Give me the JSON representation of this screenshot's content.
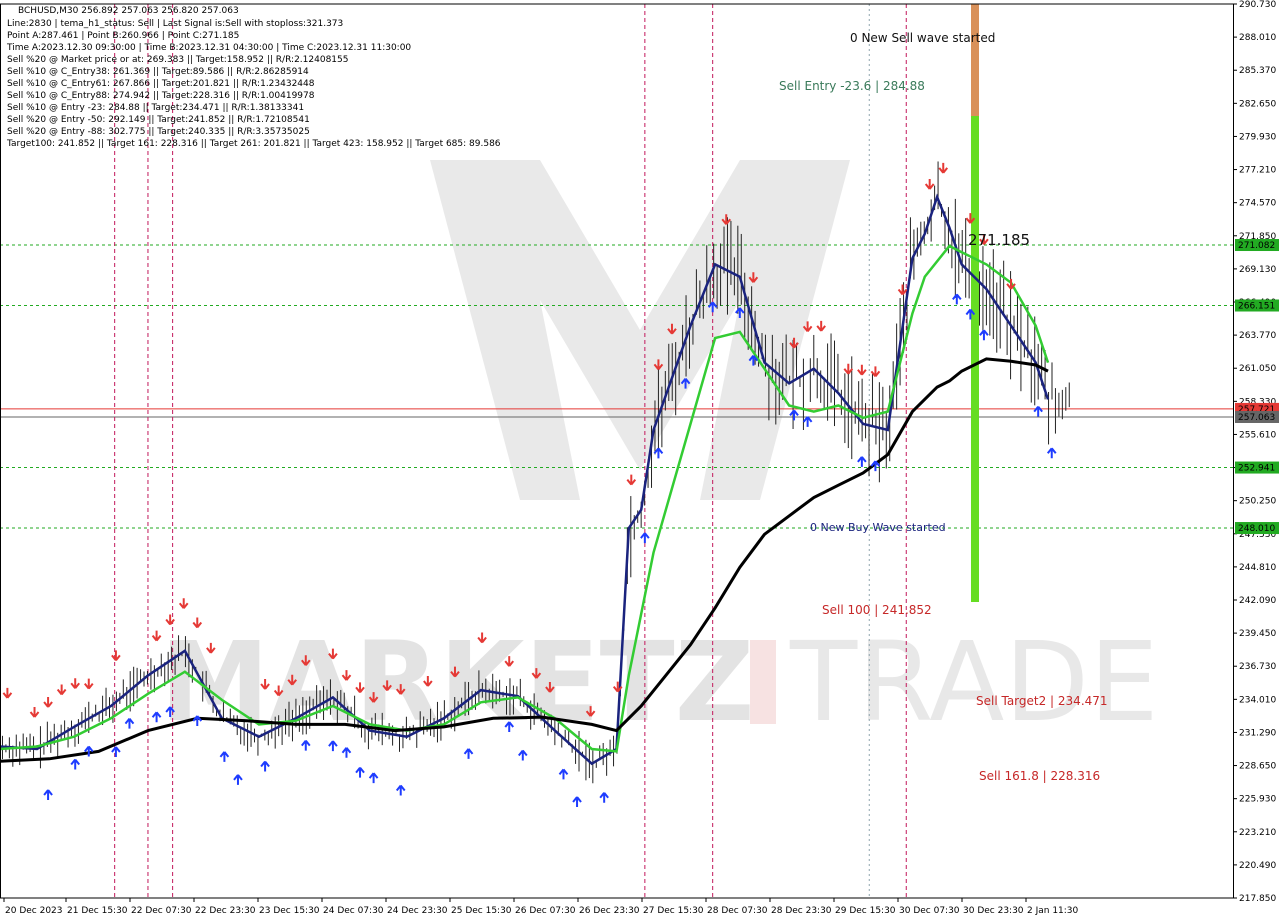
{
  "chart_data": {
    "type": "candlestick",
    "symbol_line": "BCHUSD,M30  256.892 257.063 256.820 257.063",
    "info_lines": [
      "Line:2830 | tema_h1_status: Sell | Last Signal is:Sell with stoploss:321.373",
      "Point A:287.461 | Point B:260.966 | Point C:271.185",
      "Time A:2023.12.30 09:30:00 | Time B:2023.12.31 04:30:00 | Time C:2023.12.31 11:30:00",
      "Sell %20 @ Market price or at: 269.383 || Target:158.952 || R/R:2.12408155",
      "Sell %10 @ C_Entry38: 261.369 || Target:89.586 || R/R:2.86285914",
      "Sell %10 @ C_Entry61: 267.866 || Target:201.821 || R/R:1.23432448",
      "Sell %10 @ C_Entry88: 274.942 || Target:228.316 || R/R:1.00419978",
      "Sell %10 @ Entry -23: 284.88 || Target:234.471 || R/R:1.38133341",
      "Sell %20 @ Entry -50: 292.149 || Target:241.852 || R/R:1.72108541",
      "Sell %20 @ Entry -88: 302.775 || Target:240.335 || R/R:3.35735025",
      "Target100: 241.852 || Target 161: 228.316 || Target 261: 201.821 || Target 423: 158.952 || Target 685: 89.586"
    ],
    "y_ticks": [
      "290.730",
      "288.010",
      "285.370",
      "282.650",
      "279.930",
      "277.210",
      "274.570",
      "271.850",
      "269.130",
      "266.490",
      "263.770",
      "261.050",
      "258.330",
      "255.610",
      "252.970",
      "250.250",
      "247.530",
      "244.810",
      "242.090",
      "239.450",
      "236.730",
      "234.010",
      "231.290",
      "228.650",
      "225.930",
      "223.210",
      "220.490",
      "217.850"
    ],
    "ylim": [
      217.85,
      290.73
    ],
    "x_ticks": [
      "20 Dec 2023",
      "21 Dec 15:30",
      "22 Dec 07:30",
      "22 Dec 23:30",
      "23 Dec 15:30",
      "24 Dec 07:30",
      "24 Dec 23:30",
      "25 Dec 15:30",
      "26 Dec 07:30",
      "26 Dec 23:30",
      "27 Dec 15:30",
      "28 Dec 07:30",
      "28 Dec 23:30",
      "29 Dec 15:30",
      "30 Dec 07:30",
      "30 Dec 23:30",
      "2 Jan 11:30"
    ],
    "price_tags": [
      {
        "value": 271.082,
        "label": "271.082",
        "color": "#22aa22"
      },
      {
        "value": 266.151,
        "label": "266.151",
        "color": "#22aa22"
      },
      {
        "value": 257.721,
        "label": "257.721",
        "color": "#e53935"
      },
      {
        "value": 257.063,
        "label": "257.063",
        "color": "#666666"
      },
      {
        "value": 252.941,
        "label": "252.941",
        "color": "#22aa22"
      },
      {
        "value": 248.01,
        "label": "248.010",
        "color": "#22aa22"
      }
    ],
    "annotations": [
      {
        "text": "0 New Sell wave started",
        "color": "#111111"
      },
      {
        "text": "Sell Entry -23.6 | 284.88",
        "color": "#3a7a5a"
      },
      {
        "text": "271.185",
        "color": "#111111"
      },
      {
        "text": "0 New Buy Wave started",
        "color": "#1a237e"
      },
      {
        "text": "Sell 100 | 241.852",
        "color": "#c62828"
      },
      {
        "text": "Sell Target2 | 234.471",
        "color": "#c62828"
      },
      {
        "text": "Sell 161.8 | 228.316",
        "color": "#c62828"
      }
    ],
    "series": [
      {
        "name": "",
        "color": "#1a237e",
        "x": [
          0,
          0.03,
          0.06,
          0.09,
          0.12,
          0.15,
          0.18,
          0.21,
          0.24,
          0.27,
          0.3,
          0.33,
          0.36,
          0.39,
          0.42,
          0.45,
          0.48,
          0.5,
          0.51,
          0.52,
          0.53,
          0.56,
          0.58,
          0.6,
          0.62,
          0.64,
          0.66,
          0.68,
          0.7,
          0.72,
          0.74,
          0.75,
          0.76,
          0.77,
          0.78,
          0.8,
          0.82,
          0.84,
          0.85
        ],
        "y": [
          230.2,
          230.0,
          231.8,
          233.5,
          236.0,
          238.0,
          232.5,
          231.0,
          232.5,
          234.2,
          231.5,
          231.0,
          232.5,
          234.8,
          234.3,
          231.5,
          228.8,
          230.0,
          248.0,
          249.5,
          256.0,
          264.5,
          269.5,
          268.5,
          261.5,
          259.8,
          261.0,
          259.0,
          256.5,
          256.0,
          270.0,
          272.0,
          275.0,
          272.5,
          269.5,
          267.5,
          264.5,
          261.5,
          258.5
        ]
      },
      {
        "name": "",
        "color": "#33cc33",
        "x": [
          0,
          0.03,
          0.06,
          0.09,
          0.12,
          0.15,
          0.18,
          0.21,
          0.24,
          0.27,
          0.3,
          0.33,
          0.36,
          0.39,
          0.42,
          0.45,
          0.48,
          0.5,
          0.51,
          0.53,
          0.56,
          0.58,
          0.6,
          0.62,
          0.64,
          0.66,
          0.68,
          0.7,
          0.72,
          0.74,
          0.75,
          0.77,
          0.78,
          0.8,
          0.82,
          0.84,
          0.85
        ],
        "y": [
          230.0,
          230.2,
          231.0,
          232.5,
          234.5,
          236.3,
          234.0,
          232.0,
          232.3,
          233.5,
          232.0,
          231.5,
          232.0,
          233.8,
          234.2,
          232.5,
          230.0,
          229.8,
          236.0,
          246.0,
          256.5,
          263.5,
          264.0,
          261.0,
          258.0,
          257.5,
          258.0,
          257.0,
          257.5,
          265.5,
          268.5,
          271.0,
          270.5,
          269.5,
          268.0,
          264.5,
          261.5
        ]
      },
      {
        "name": "",
        "color": "#000000",
        "x": [
          0,
          0.04,
          0.08,
          0.12,
          0.16,
          0.2,
          0.24,
          0.28,
          0.32,
          0.36,
          0.4,
          0.44,
          0.48,
          0.5,
          0.52,
          0.54,
          0.56,
          0.58,
          0.6,
          0.62,
          0.64,
          0.66,
          0.68,
          0.7,
          0.72,
          0.74,
          0.76,
          0.77,
          0.78,
          0.8,
          0.82,
          0.84,
          0.85
        ],
        "y": [
          229.0,
          229.2,
          229.8,
          231.5,
          232.5,
          232.3,
          232.0,
          232.0,
          231.5,
          231.8,
          232.5,
          232.6,
          232.0,
          231.5,
          233.5,
          236.0,
          238.5,
          241.5,
          244.8,
          247.5,
          249.0,
          250.5,
          251.5,
          252.5,
          254.0,
          257.5,
          259.5,
          260.0,
          260.8,
          261.8,
          261.6,
          261.3,
          260.8
        ]
      }
    ]
  }
}
